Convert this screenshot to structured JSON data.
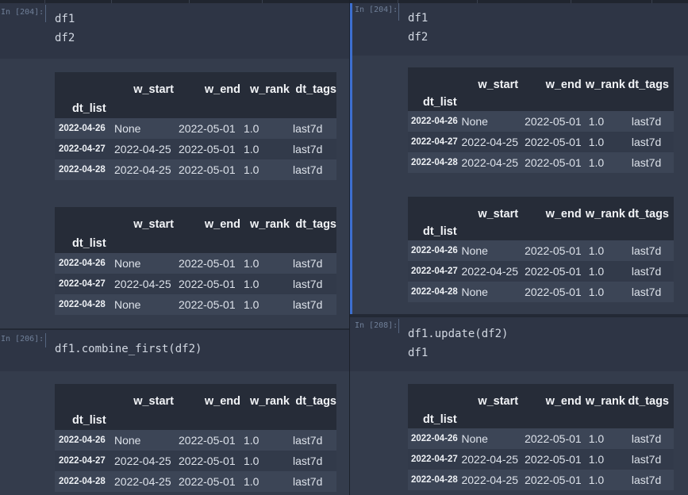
{
  "left_pane": {
    "cells": [
      {
        "prompt": "In [204]:",
        "code": [
          "df1",
          "df2"
        ],
        "outputs": [
          {
            "columns": [
              "w_start",
              "w_end",
              "w_rank",
              "dt_tags"
            ],
            "index_name": "dt_list",
            "rows": [
              {
                "index": "2022-04-26",
                "values": [
                  "None",
                  "2022-05-01",
                  "1.0",
                  "last7d"
                ]
              },
              {
                "index": "2022-04-27",
                "values": [
                  "2022-04-25",
                  "2022-05-01",
                  "1.0",
                  "last7d"
                ]
              },
              {
                "index": "2022-04-28",
                "values": [
                  "2022-04-25",
                  "2022-05-01",
                  "1.0",
                  "last7d"
                ]
              }
            ]
          },
          {
            "columns": [
              "w_start",
              "w_end",
              "w_rank",
              "dt_tags"
            ],
            "index_name": "dt_list",
            "rows": [
              {
                "index": "2022-04-26",
                "values": [
                  "None",
                  "2022-05-01",
                  "1.0",
                  "last7d"
                ]
              },
              {
                "index": "2022-04-27",
                "values": [
                  "2022-04-25",
                  "2022-05-01",
                  "1.0",
                  "last7d"
                ]
              },
              {
                "index": "2022-04-28",
                "values": [
                  "None",
                  "2022-05-01",
                  "1.0",
                  "last7d"
                ]
              }
            ]
          }
        ]
      },
      {
        "prompt": "In [206]:",
        "code": [
          "df1.combine_first(df2)"
        ],
        "outputs": [
          {
            "columns": [
              "w_start",
              "w_end",
              "w_rank",
              "dt_tags"
            ],
            "index_name": "dt_list",
            "rows": [
              {
                "index": "2022-04-26",
                "values": [
                  "None",
                  "2022-05-01",
                  "1.0",
                  "last7d"
                ]
              },
              {
                "index": "2022-04-27",
                "values": [
                  "2022-04-25",
                  "2022-05-01",
                  "1.0",
                  "last7d"
                ]
              },
              {
                "index": "2022-04-28",
                "values": [
                  "2022-04-25",
                  "2022-05-01",
                  "1.0",
                  "last7d"
                ]
              }
            ]
          }
        ]
      }
    ]
  },
  "right_pane": {
    "cells": [
      {
        "prompt": "In [204]:",
        "code": [
          "df1",
          "df2"
        ],
        "outputs": [
          {
            "columns": [
              "w_start",
              "w_end",
              "w_rank",
              "dt_tags"
            ],
            "index_name": "dt_list",
            "rows": [
              {
                "index": "2022-04-26",
                "values": [
                  "None",
                  "2022-05-01",
                  "1.0",
                  "last7d"
                ]
              },
              {
                "index": "2022-04-27",
                "values": [
                  "2022-04-25",
                  "2022-05-01",
                  "1.0",
                  "last7d"
                ]
              },
              {
                "index": "2022-04-28",
                "values": [
                  "2022-04-25",
                  "2022-05-01",
                  "1.0",
                  "last7d"
                ]
              }
            ]
          },
          {
            "columns": [
              "w_start",
              "w_end",
              "w_rank",
              "dt_tags"
            ],
            "index_name": "dt_list",
            "rows": [
              {
                "index": "2022-04-26",
                "values": [
                  "None",
                  "2022-05-01",
                  "1.0",
                  "last7d"
                ]
              },
              {
                "index": "2022-04-27",
                "values": [
                  "2022-04-25",
                  "2022-05-01",
                  "1.0",
                  "last7d"
                ]
              },
              {
                "index": "2022-04-28",
                "values": [
                  "None",
                  "2022-05-01",
                  "1.0",
                  "last7d"
                ]
              }
            ]
          }
        ]
      },
      {
        "prompt": "In [208]:",
        "code": [
          "df1.update(df2)",
          "df1"
        ],
        "outputs": [
          {
            "columns": [
              "w_start",
              "w_end",
              "w_rank",
              "dt_tags"
            ],
            "index_name": "dt_list",
            "rows": [
              {
                "index": "2022-04-26",
                "values": [
                  "None",
                  "2022-05-01",
                  "1.0",
                  "last7d"
                ]
              },
              {
                "index": "2022-04-27",
                "values": [
                  "2022-04-25",
                  "2022-05-01",
                  "1.0",
                  "last7d"
                ]
              },
              {
                "index": "2022-04-28",
                "values": [
                  "2022-04-25",
                  "2022-05-01",
                  "1.0",
                  "last7d"
                ]
              }
            ]
          }
        ]
      }
    ]
  },
  "colors": {
    "background": "#2b3240",
    "input_area": "#2e3545",
    "output_area": "#343c4c",
    "selected_cell_bar": "#3d6fd0",
    "table_header": "#262c38",
    "row_odd": "#3c4556",
    "row_even": "#323a4a"
  }
}
